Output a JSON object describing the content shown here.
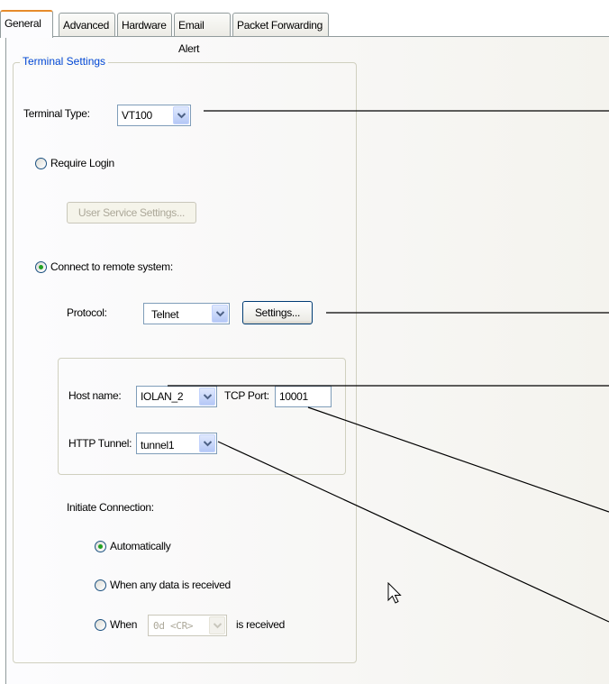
{
  "tabs": [
    "General",
    "Advanced",
    "Hardware",
    "Email Alert",
    "Packet Forwarding"
  ],
  "terminal_settings": {
    "legend": "Terminal Settings",
    "terminal_type_label": "Terminal Type:",
    "terminal_type_value": "VT100",
    "require_login_label": "Require Login",
    "user_service_settings_label": "User Service Settings...",
    "connect_remote_label": "Connect to remote system:",
    "protocol_label": "Protocol:",
    "protocol_value": "Telnet",
    "settings_button_label": "Settings...",
    "host_name_label": "Host name:",
    "host_name_value": "IOLAN_2",
    "tcp_port_label": "TCP Port:",
    "tcp_port_value": "10001",
    "http_tunnel_label": "HTTP Tunnel:",
    "http_tunnel_value": "tunnel1",
    "initiate_connection_label": "Initiate Connection:",
    "automatically_label": "Automatically",
    "when_any_data_label": "When any data is received",
    "when_label": "When",
    "when_value": "0d <CR>",
    "is_received_label": "is received"
  },
  "selection": {
    "connection_mode": "connect-to-remote-system",
    "initiate_connection": "automatically"
  },
  "icons": [
    "chevron-down-icon",
    "mouse-cursor-icon"
  ],
  "colors": {
    "active_tab_accent": "#e68b2c",
    "legend_text": "#0046d5",
    "radio_dot": "#21a121",
    "disabled_text": "#aca899"
  }
}
